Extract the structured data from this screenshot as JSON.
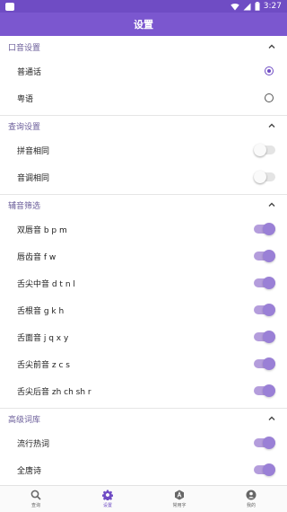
{
  "status_bar": {
    "time": "3:27"
  },
  "app_bar": {
    "title": "设置"
  },
  "sections": [
    {
      "title": "口音设置",
      "rows": [
        {
          "label": "普通话",
          "control": "radio",
          "checked": true
        },
        {
          "label": "粤语",
          "control": "radio",
          "checked": false
        }
      ]
    },
    {
      "title": "查询设置",
      "rows": [
        {
          "label": "拼音相同",
          "control": "switch",
          "checked": false
        },
        {
          "label": "音调相同",
          "control": "switch",
          "checked": false
        }
      ]
    },
    {
      "title": "辅音筛选",
      "rows": [
        {
          "label": "双唇音 b p m",
          "control": "switch",
          "checked": true
        },
        {
          "label": "唇齿音 f w",
          "control": "switch",
          "checked": true
        },
        {
          "label": "舌尖中音 d t n l",
          "control": "switch",
          "checked": true
        },
        {
          "label": "舌根音 g k h",
          "control": "switch",
          "checked": true
        },
        {
          "label": "舌面音 j q x y",
          "control": "switch",
          "checked": true
        },
        {
          "label": "舌尖前音 z c s",
          "control": "switch",
          "checked": true
        },
        {
          "label": "舌尖后音 zh ch sh r",
          "control": "switch",
          "checked": true
        }
      ]
    },
    {
      "title": "高级词库",
      "rows": [
        {
          "label": "流行热词",
          "control": "switch",
          "checked": true
        },
        {
          "label": "全唐诗",
          "control": "switch",
          "checked": true
        }
      ]
    }
  ],
  "bottom_nav": [
    {
      "label": "查询",
      "icon": "search-icon",
      "active": false
    },
    {
      "label": "设置",
      "icon": "gear-icon",
      "active": true
    },
    {
      "label": "常用字",
      "icon": "font-icon",
      "active": false
    },
    {
      "label": "我的",
      "icon": "account-icon",
      "active": false
    }
  ],
  "colors": {
    "accent": "#7b57cf",
    "status_bar": "#6f4cc4",
    "switch_on_track": "#b49ddc",
    "switch_on_thumb": "#9a80d6",
    "section_header_text": "#6b5e9a"
  }
}
